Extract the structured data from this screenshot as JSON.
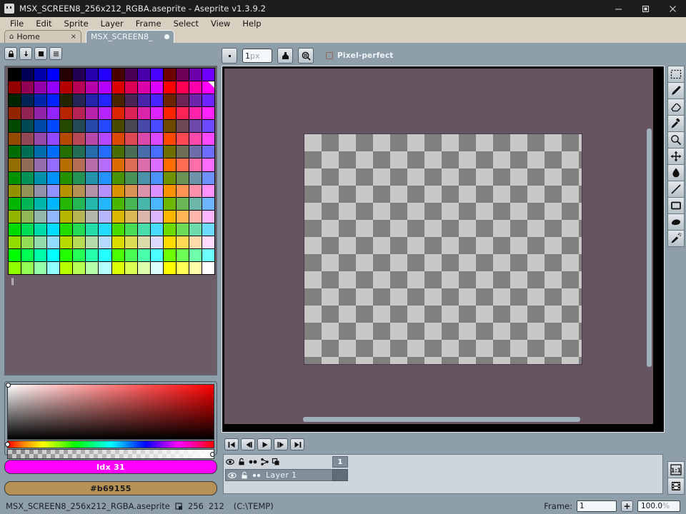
{
  "window": {
    "title": "MSX_SCREEN8_256x212_RGBA.aseprite - Aseprite v1.3.9.2",
    "app_icon": "aseprite-icon",
    "controls": {
      "minimize": "minimize-icon",
      "maximize": "maximize-icon",
      "close": "close-icon"
    }
  },
  "menubar": {
    "items": [
      {
        "label": "File",
        "accel": "F"
      },
      {
        "label": "Edit",
        "accel": "E"
      },
      {
        "label": "Sprite",
        "accel": "S"
      },
      {
        "label": "Layer",
        "accel": "L"
      },
      {
        "label": "Frame",
        "accel": "r"
      },
      {
        "label": "Select",
        "accel": "t"
      },
      {
        "label": "View",
        "accel": "V"
      },
      {
        "label": "Help",
        "accel": "H"
      }
    ]
  },
  "tabs": [
    {
      "label": "Home",
      "icon": "home-icon",
      "active": false,
      "close": "×"
    },
    {
      "label": "MSX_SCREEN8_",
      "icon": "modified-dot",
      "active": true
    }
  ],
  "palette_panel": {
    "toolbar": [
      {
        "name": "lock-palette-button",
        "icon": "lock-icon"
      },
      {
        "name": "sort-palette-button",
        "icon": "arrow-down-icon"
      },
      {
        "name": "palette-presets-button",
        "icon": "filled-square-icon"
      },
      {
        "name": "palette-options-button",
        "icon": "hamburger-icon"
      }
    ],
    "columns": 16,
    "rows": 16,
    "selected_index": 31,
    "resize_handle": "‖"
  },
  "color_picker": {
    "sv_box": "saturation-value-box",
    "hue_slider": "hue-slider",
    "alpha_slider": "alpha-slider",
    "index_label": "Idx 31",
    "index_swatch_color": "#ff00ff",
    "hex_label": "#b69155",
    "hex_swatch_color": "#b69155"
  },
  "context_bar": {
    "brush_preview": "brush-preview",
    "brush_size_value": "1",
    "brush_size_unit": "px",
    "ink_button": "ink-icon",
    "blend_button": "blend-mode-icon",
    "pixel_perfect": {
      "label": "Pixel-perfect",
      "checked": false
    }
  },
  "editor": {
    "background_color": "#665561",
    "sprite_width": 256,
    "sprite_height": 212,
    "checker_light": "#c8c8c8",
    "checker_dark": "#808080"
  },
  "tools": [
    {
      "name": "rectangular-marquee-tool",
      "icon": "marquee-icon",
      "selected": false
    },
    {
      "name": "pencil-tool",
      "icon": "pencil-icon",
      "selected": false
    },
    {
      "name": "eraser-tool",
      "icon": "eraser-icon",
      "selected": false
    },
    {
      "name": "eyedropper-tool",
      "icon": "eyedropper-icon",
      "selected": false
    },
    {
      "name": "zoom-tool",
      "icon": "magnifier-icon",
      "selected": false
    },
    {
      "name": "move-tool",
      "icon": "move-arrows-icon",
      "selected": false
    },
    {
      "name": "paint-bucket-tool",
      "icon": "paint-bucket-icon",
      "selected": false
    },
    {
      "name": "line-tool",
      "icon": "line-icon",
      "selected": false
    },
    {
      "name": "rectangle-tool",
      "icon": "rectangle-icon",
      "selected": false
    },
    {
      "name": "contour-tool",
      "icon": "blob-icon",
      "selected": false
    },
    {
      "name": "spray-tool",
      "icon": "spray-icon",
      "selected": false
    }
  ],
  "bottom_tools": [
    {
      "name": "zoom-one-to-one-button",
      "label": "1:1",
      "icon": "one-to-one-icon"
    },
    {
      "name": "toggle-timeline-button",
      "icon": "film-strip-icon"
    }
  ],
  "timeline": {
    "playback": [
      {
        "name": "go-first-frame-button",
        "icon": "skip-back-icon"
      },
      {
        "name": "go-prev-frame-button",
        "icon": "step-back-icon"
      },
      {
        "name": "play-button",
        "icon": "play-icon"
      },
      {
        "name": "go-next-frame-button",
        "icon": "step-forward-icon"
      },
      {
        "name": "go-last-frame-button",
        "icon": "skip-forward-icon"
      }
    ],
    "header_icons": [
      {
        "name": "visibility-all-icon",
        "icon": "eye-icon"
      },
      {
        "name": "lock-all-icon",
        "icon": "padlock-icon"
      },
      {
        "name": "continuous-all-icon",
        "icon": "two-dots-icon"
      },
      {
        "name": "onion-skin-icon",
        "icon": "onion-icon"
      },
      {
        "name": "duplicate-icon",
        "icon": "copy-icon"
      }
    ],
    "frame_numbers": [
      "1"
    ],
    "layers": [
      {
        "name": "Layer 1",
        "visible": true,
        "locked": false,
        "continuous": true
      }
    ]
  },
  "statusbar": {
    "filename": "MSX_SCREEN8_256x212_RGBA.aseprite",
    "sprite_icon": "sprite-size-icon",
    "width": "256",
    "height": "212",
    "path": "(C:\\TEMP)",
    "frame_label": "Frame:",
    "frame_value": "1",
    "add_frame_label": "+",
    "zoom_value": "100.0",
    "zoom_unit": "%"
  }
}
